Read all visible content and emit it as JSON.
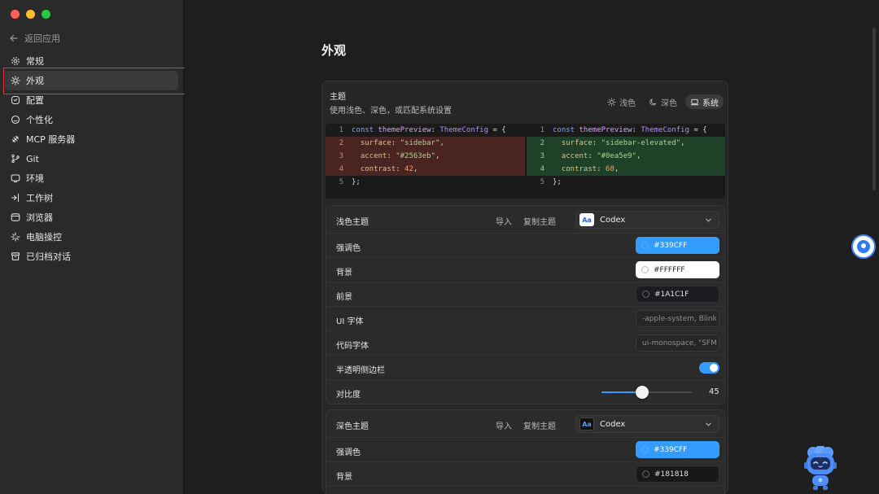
{
  "window": {
    "traffic_lights": {
      "close": "#ff5f57",
      "minimize": "#febc2e",
      "zoom": "#28c840"
    }
  },
  "sidebar": {
    "back_label": "返回应用",
    "items": [
      {
        "label": "常规",
        "icon": "gear-icon"
      },
      {
        "label": "外观",
        "icon": "sun-icon",
        "active": true
      },
      {
        "label": "配置",
        "icon": "config-icon"
      },
      {
        "label": "个性化",
        "icon": "personalize-icon"
      },
      {
        "label": "MCP 服务器",
        "icon": "server-icon"
      },
      {
        "label": "Git",
        "icon": "git-branch-icon"
      },
      {
        "label": "环境",
        "icon": "monitor-icon"
      },
      {
        "label": "工作树",
        "icon": "worktree-icon"
      },
      {
        "label": "浏览器",
        "icon": "browser-icon"
      },
      {
        "label": "电脑操控",
        "icon": "sparkle-icon"
      },
      {
        "label": "已归档对话",
        "icon": "archive-icon"
      }
    ]
  },
  "main": {
    "title": "外观",
    "theme": {
      "title": "主题",
      "subtitle": "使用浅色、深色，或匹配系统设置",
      "modes": [
        {
          "label": "浅色",
          "icon": "sun-icon",
          "active": false
        },
        {
          "label": "深色",
          "icon": "moon-icon",
          "active": false
        },
        {
          "label": "系统",
          "icon": "laptop-icon",
          "active": true
        }
      ]
    },
    "code_preview": {
      "left": {
        "line1": {
          "num": "1",
          "kw": "const",
          "name": "themePreview",
          "colon": ":",
          "type": "ThemeConfig",
          "rest": " = {"
        },
        "line2": {
          "num": "2",
          "key": "surface",
          "value": "\"sidebar\""
        },
        "line3": {
          "num": "3",
          "key": "accent",
          "value": "\"#2563eb\""
        },
        "line4": {
          "num": "4",
          "key": "contrast",
          "value": "42"
        },
        "line5": {
          "num": "5",
          "text": "};"
        }
      },
      "right": {
        "line1": {
          "num": "1",
          "kw": "const",
          "name": "themePreview",
          "colon": ":",
          "type": "ThemeConfig",
          "rest": " = {"
        },
        "line2": {
          "num": "2",
          "key": "surface",
          "value": "\"sidebar-elevated\""
        },
        "line3": {
          "num": "3",
          "key": "accent",
          "value": "\"#0ea5e9\""
        },
        "line4": {
          "num": "4",
          "key": "contrast",
          "value": "68"
        },
        "line5": {
          "num": "5",
          "text": "};"
        }
      }
    },
    "light_theme": {
      "title": "浅色主题",
      "import_label": "导入",
      "copy_label": "复制主题",
      "select_icon_text": "Aa",
      "select_value": "Codex",
      "rows": {
        "accent": {
          "label": "强调色",
          "value": "#339CFF"
        },
        "background": {
          "label": "背景",
          "value": "#FFFFFF"
        },
        "foreground": {
          "label": "前景",
          "value": "#1A1C1F"
        },
        "ui_font": {
          "label": "UI 字体",
          "placeholder": "-apple-system, Blink"
        },
        "code_font": {
          "label": "代码字体",
          "placeholder": "ui-monospace, \"SFM"
        },
        "translucent_sidebar": {
          "label": "半透明侧边栏",
          "on": true
        },
        "contrast": {
          "label": "对比度",
          "value": "45",
          "fraction": 0.45
        }
      }
    },
    "dark_theme": {
      "title": "深色主题",
      "import_label": "导入",
      "copy_label": "复制主题",
      "select_icon_text": "Aa",
      "select_value": "Codex",
      "rows": {
        "accent": {
          "label": "强调色",
          "value": "#339CFF"
        },
        "background": {
          "label": "背景",
          "value": "#181818"
        }
      }
    }
  }
}
